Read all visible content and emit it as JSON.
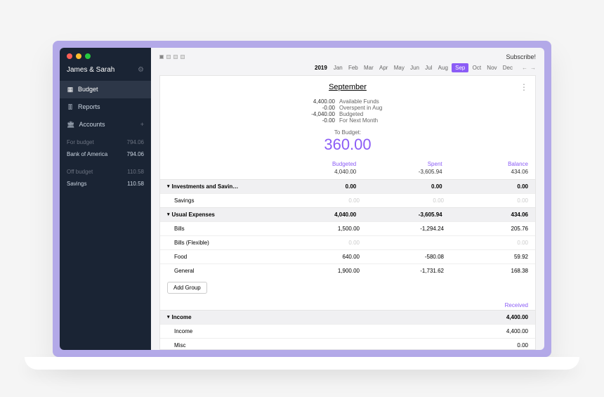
{
  "toolbar": {
    "subscribe": "Subscribe!"
  },
  "sidebar": {
    "budget_name": "James & Sarah",
    "nav": {
      "budget": "Budget",
      "reports": "Reports",
      "accounts": "Accounts"
    },
    "for_budget_label": "For budget",
    "for_budget_total": "794.06",
    "for_budget_accounts": [
      {
        "name": "Bank of America",
        "balance": "794.06"
      }
    ],
    "off_budget_label": "Off budget",
    "off_budget_total": "110.58",
    "off_budget_accounts": [
      {
        "name": "Savings",
        "balance": "110.58"
      }
    ]
  },
  "timeline": {
    "year": "2019",
    "months": [
      "Jan",
      "Feb",
      "Mar",
      "Apr",
      "May",
      "Jun",
      "Jul",
      "Aug",
      "Sep",
      "Oct",
      "Nov",
      "Dec"
    ],
    "active": "Sep"
  },
  "budget_header": {
    "month_name": "September",
    "rows": [
      {
        "amount": "4,400.00",
        "label": "Available Funds"
      },
      {
        "amount": "-0.00",
        "label": "Overspent in Aug"
      },
      {
        "amount": "-4,040.00",
        "label": "Budgeted"
      },
      {
        "amount": "-0.00",
        "label": "For Next Month"
      }
    ],
    "to_budget_label": "To Budget:",
    "to_budget_amount": "360.00",
    "columns": {
      "budgeted": "Budgeted",
      "spent": "Spent",
      "balance": "Balance"
    },
    "totals": {
      "budgeted": "4,040.00",
      "spent": "-3,605.94",
      "balance": "434.06"
    }
  },
  "groups": [
    {
      "name": "Investments and Savin…",
      "budgeted": "0.00",
      "spent": "0.00",
      "balance": "0.00",
      "categories": [
        {
          "name": "Savings",
          "budgeted": "0.00",
          "spent": "0.00",
          "balance": "0.00",
          "dim": true
        }
      ]
    },
    {
      "name": "Usual Expenses",
      "budgeted": "4,040.00",
      "spent": "-3,605.94",
      "balance": "434.06",
      "categories": [
        {
          "name": "Bills",
          "budgeted": "1,500.00",
          "spent": "-1,294.24",
          "balance": "205.76"
        },
        {
          "name": "Bills (Flexible)",
          "budgeted": "0.00",
          "spent": "",
          "balance": "0.00",
          "dim": true
        },
        {
          "name": "Food",
          "budgeted": "640.00",
          "spent": "-580.08",
          "balance": "59.92"
        },
        {
          "name": "General",
          "budgeted": "1,900.00",
          "spent": "-1,731.62",
          "balance": "168.38"
        }
      ]
    }
  ],
  "add_group_label": "Add Group",
  "income": {
    "received_label": "Received",
    "group_name": "Income",
    "group_total": "4,400.00",
    "categories": [
      {
        "name": "Income",
        "amount": "4,400.00"
      },
      {
        "name": "Misc",
        "amount": "0.00"
      }
    ]
  }
}
